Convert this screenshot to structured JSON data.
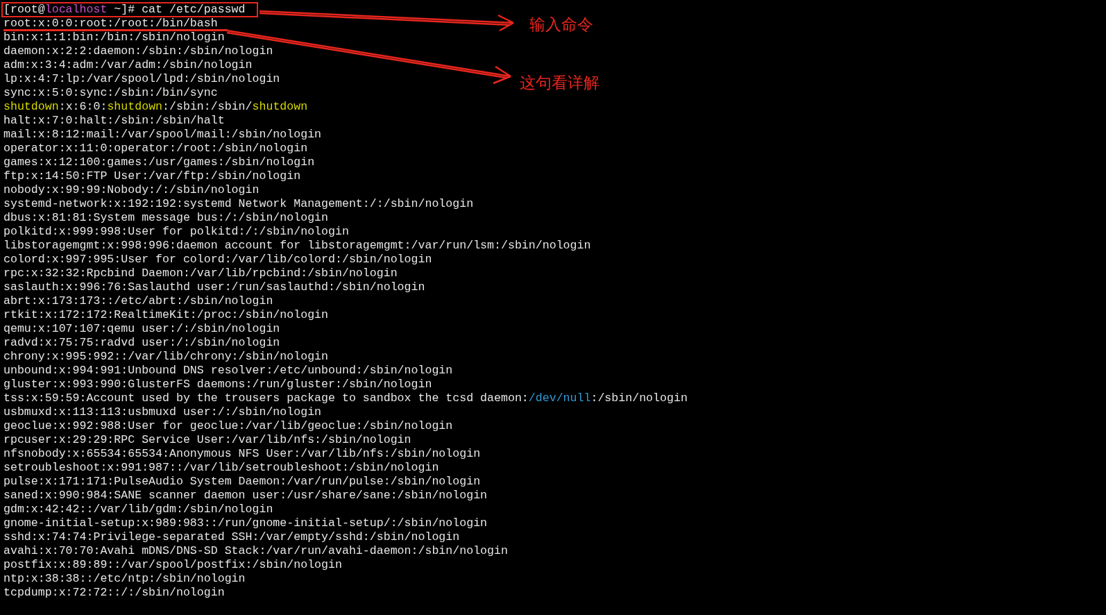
{
  "terminal": {
    "lines": [
      {
        "boxed": true,
        "segments": [
          {
            "text": "[root@"
          },
          {
            "text": "localhost",
            "color": "#c84fc8"
          },
          {
            "text": " ~]# cat /etc/passwd"
          }
        ]
      },
      {
        "underlined": true,
        "text": "root:x:0:0:root:/root:/bin/bash"
      },
      {
        "text": "bin:x:1:1:bin:/bin:/sbin/nologin"
      },
      {
        "text": "daemon:x:2:2:daemon:/sbin:/sbin/nologin"
      },
      {
        "text": "adm:x:3:4:adm:/var/adm:/sbin/nologin"
      },
      {
        "text": "lp:x:4:7:lp:/var/spool/lpd:/sbin/nologin"
      },
      {
        "text": "sync:x:5:0:sync:/sbin:/bin/sync"
      },
      {
        "segments": [
          {
            "text": "shutdown",
            "color": "#d7d700"
          },
          {
            "text": ":x:6:0:"
          },
          {
            "text": "shutdown",
            "color": "#d7d700"
          },
          {
            "text": ":/sbin:/sbin/"
          },
          {
            "text": "shutdown",
            "color": "#d7d700"
          }
        ]
      },
      {
        "text": "halt:x:7:0:halt:/sbin:/sbin/halt"
      },
      {
        "text": "mail:x:8:12:mail:/var/spool/mail:/sbin/nologin"
      },
      {
        "text": "operator:x:11:0:operator:/root:/sbin/nologin"
      },
      {
        "text": "games:x:12:100:games:/usr/games:/sbin/nologin"
      },
      {
        "text": "ftp:x:14:50:FTP User:/var/ftp:/sbin/nologin"
      },
      {
        "text": "nobody:x:99:99:Nobody:/:/sbin/nologin"
      },
      {
        "text": "systemd-network:x:192:192:systemd Network Management:/:/sbin/nologin"
      },
      {
        "text": "dbus:x:81:81:System message bus:/:/sbin/nologin"
      },
      {
        "text": "polkitd:x:999:998:User for polkitd:/:/sbin/nologin"
      },
      {
        "text": "libstoragemgmt:x:998:996:daemon account for libstoragemgmt:/var/run/lsm:/sbin/nologin"
      },
      {
        "text": "colord:x:997:995:User for colord:/var/lib/colord:/sbin/nologin"
      },
      {
        "text": "rpc:x:32:32:Rpcbind Daemon:/var/lib/rpcbind:/sbin/nologin"
      },
      {
        "text": "saslauth:x:996:76:Saslauthd user:/run/saslauthd:/sbin/nologin"
      },
      {
        "text": "abrt:x:173:173::/etc/abrt:/sbin/nologin"
      },
      {
        "text": "rtkit:x:172:172:RealtimeKit:/proc:/sbin/nologin"
      },
      {
        "text": "qemu:x:107:107:qemu user:/:/sbin/nologin"
      },
      {
        "text": "radvd:x:75:75:radvd user:/:/sbin/nologin"
      },
      {
        "text": "chrony:x:995:992::/var/lib/chrony:/sbin/nologin"
      },
      {
        "text": "unbound:x:994:991:Unbound DNS resolver:/etc/unbound:/sbin/nologin"
      },
      {
        "text": "gluster:x:993:990:GlusterFS daemons:/run/gluster:/sbin/nologin"
      },
      {
        "segments": [
          {
            "text": "tss:x:59:59:Account used by the trousers package to sandbox the tcsd daemon:"
          },
          {
            "text": "/dev/null",
            "color": "#2e9bd6"
          },
          {
            "text": ":/sbin/nologin"
          }
        ]
      },
      {
        "text": "usbmuxd:x:113:113:usbmuxd user:/:/sbin/nologin"
      },
      {
        "text": "geoclue:x:992:988:User for geoclue:/var/lib/geoclue:/sbin/nologin"
      },
      {
        "text": "rpcuser:x:29:29:RPC Service User:/var/lib/nfs:/sbin/nologin"
      },
      {
        "text": "nfsnobody:x:65534:65534:Anonymous NFS User:/var/lib/nfs:/sbin/nologin"
      },
      {
        "text": "setroubleshoot:x:991:987::/var/lib/setroubleshoot:/sbin/nologin"
      },
      {
        "text": "pulse:x:171:171:PulseAudio System Daemon:/var/run/pulse:/sbin/nologin"
      },
      {
        "text": "saned:x:990:984:SANE scanner daemon user:/usr/share/sane:/sbin/nologin"
      },
      {
        "text": "gdm:x:42:42::/var/lib/gdm:/sbin/nologin"
      },
      {
        "text": "gnome-initial-setup:x:989:983::/run/gnome-initial-setup/:/sbin/nologin"
      },
      {
        "text": "sshd:x:74:74:Privilege-separated SSH:/var/empty/sshd:/sbin/nologin"
      },
      {
        "text": "avahi:x:70:70:Avahi mDNS/DNS-SD Stack:/var/run/avahi-daemon:/sbin/nologin"
      },
      {
        "text": "postfix:x:89:89::/var/spool/postfix:/sbin/nologin"
      },
      {
        "text": "ntp:x:38:38::/etc/ntp:/sbin/nologin"
      },
      {
        "text": "tcpdump:x:72:72::/:/sbin/nologin"
      }
    ]
  },
  "annotations": [
    {
      "label": "输入命令"
    },
    {
      "label": "这句看详解"
    }
  ]
}
